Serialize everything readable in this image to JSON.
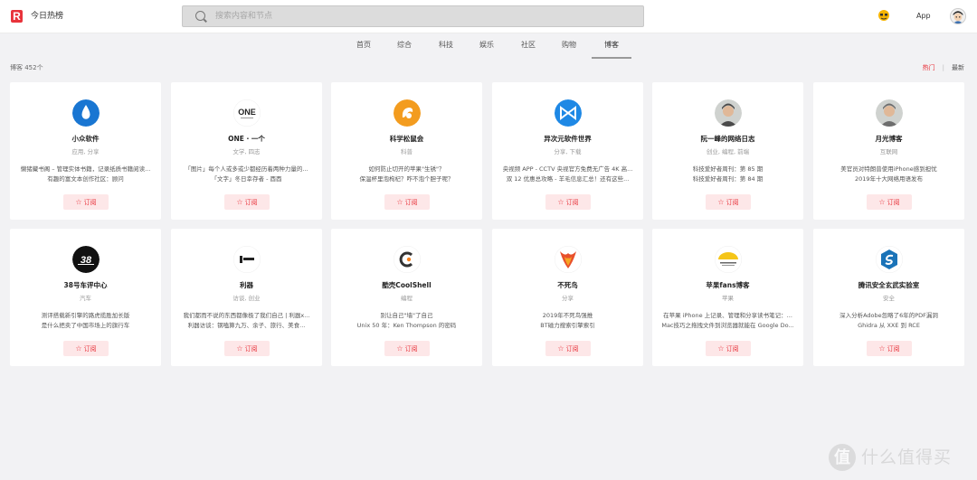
{
  "header": {
    "logo_letter": "R",
    "title": "今日热榜",
    "search_placeholder": "搜索内容和节点",
    "app_label": "App"
  },
  "tabs": [
    {
      "label": "首页",
      "active": false
    },
    {
      "label": "综合",
      "active": false
    },
    {
      "label": "科技",
      "active": false
    },
    {
      "label": "娱乐",
      "active": false
    },
    {
      "label": "社区",
      "active": false
    },
    {
      "label": "购物",
      "active": false
    },
    {
      "label": "博客",
      "active": true
    }
  ],
  "listing": {
    "count_label": "博客 452个",
    "sort_hot": "热门",
    "sort_sep": "|",
    "sort_new": "最新"
  },
  "subscribe_label": "订阅",
  "cards": [
    {
      "name": "小众软件",
      "category": "应用, 分享",
      "desc": [
        "懒猪藏书阁 – 管理实体书籍，记录纸质书籍阅读...",
        "有趣的富文本创作社区：顾问"
      ],
      "icon": "drop-icon",
      "color": "#1976d2"
    },
    {
      "name": "ONE · 一个",
      "category": "文学, 四志",
      "desc": [
        "「图片」每个人或多或少都经历着两种力量的...",
        "「文字」冬日幸存者 - 酉酉"
      ],
      "icon": "one-logo-icon",
      "color": "#222222"
    },
    {
      "name": "科学松鼠会",
      "category": "科普",
      "desc": [
        "如何防止切开的苹果\"生锈\"？",
        "保温杯里泡枸杞？咋不泡个胆子呢？"
      ],
      "icon": "squirrel-icon",
      "color": "#f39c1f"
    },
    {
      "name": "异次元软件世界",
      "category": "分享, 下载",
      "desc": [
        "央视频 APP - CCTV 央视官方免费无广告 4K 高...",
        "双 12 优惠总攻略 - 羊毛信息汇总！还有这些..."
      ],
      "icon": "bowtie-icon",
      "color": "#1e88e5"
    },
    {
      "name": "阮一峰的网络日志",
      "category": "创业, 编程, 前端",
      "desc": [
        "科技爱好者周刊：第 85 期",
        "科技爱好者周刊：第 84 期"
      ],
      "icon": "portrait-icon",
      "color": "#4a4a4a"
    },
    {
      "name": "月光博客",
      "category": "互联网",
      "desc": [
        "美官员对特朗普使用iPhone感到担忧",
        "2019年十大网络用语发布"
      ],
      "icon": "portrait-icon",
      "color": "#6d6d6d"
    },
    {
      "name": "38号车评中心",
      "category": "汽车",
      "desc": [
        "测评搭载新引擎的路虎揽胜加长版",
        "是什么把卖了中国市场上的旗行车"
      ],
      "icon": "38-logo-icon",
      "color": "#111111"
    },
    {
      "name": "利器",
      "category": "访谈, 创业",
      "desc": [
        "我们都而不说的东西都像极了我们自己 | 利器x...",
        "利器访谈：钢嗑算九万、余子、旅行、美食..."
      ],
      "icon": "liqi-logo-icon",
      "color": "#222222"
    },
    {
      "name": "酷壳CoolShell",
      "category": "编程",
      "desc": [
        "别让自己\"墙\"了自己",
        "Unix 50 年：Ken Thompson 的密码"
      ],
      "icon": "coolshell-icon",
      "color": "#f58220"
    },
    {
      "name": "不死鸟",
      "category": "分享",
      "desc": [
        "2019年不死鸟强推",
        "BT磁力搜索引擎索引"
      ],
      "icon": "phoenix-icon",
      "color": "#e8502b"
    },
    {
      "name": "苹果fans博客",
      "category": "苹果",
      "desc": [
        "在苹果 iPhone 上记录、管理和分享读书笔记：...",
        "Mac技巧之拖拽文件到浏览器就能在 Google Do..."
      ],
      "icon": "fan-logo-icon",
      "color": "#f5c518"
    },
    {
      "name": "腾讯安全玄武实验室",
      "category": "安全",
      "desc": [
        "深入分析Adobe忽略了6年的PDF漏洞",
        "Ghidra 从 XXE 到 RCE"
      ],
      "icon": "xuanwu-icon",
      "color": "#1a73b8"
    }
  ],
  "watermark": {
    "icon_letter": "值",
    "text": "什么值得买"
  }
}
